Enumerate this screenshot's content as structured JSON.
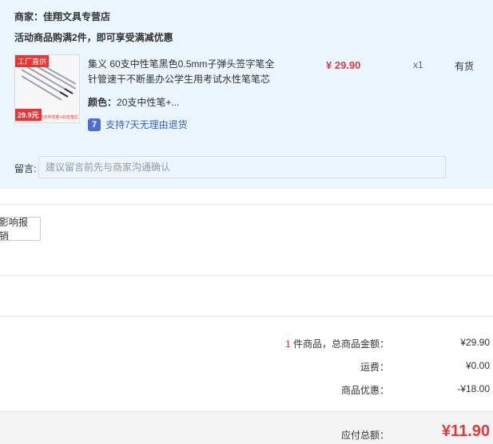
{
  "shop": {
    "merchant": "商家：佳翔文具专营店",
    "promo": "活动商品购满2件，即可享受满减优惠"
  },
  "product": {
    "thumb_badge_top": "工厂直供",
    "thumb_price": "29.9元",
    "thumb_small": "20支中性笔+60支笔芯",
    "title": "集义 60支中性笔黑色0.5mm子弹头签字笔全针管速干不断墨办公学生用考试水性笔笔芯",
    "price": "¥ 29.90",
    "qty": "x1",
    "stock": "有货",
    "color_label": "颜色：",
    "color_value": "20支中性笔+...",
    "return_icon": "7",
    "return_text": "支持7天无理由退货"
  },
  "note": {
    "label": "留言:",
    "placeholder": "建议留言前先与商家沟通确认"
  },
  "invoice": {
    "button_label": "影响报销"
  },
  "summary": {
    "count": "1",
    "items_label": " 件商品，总商品金额：",
    "items_value": "¥29.90",
    "shipping_label": "运费：",
    "shipping_value": "¥0.00",
    "discount_label": "商品优惠：",
    "discount_value": "-¥18.00",
    "total_label": "应付总额：",
    "total_value": "¥11.90"
  },
  "colors": {
    "accent_red": "#e4393c",
    "panel_bg": "#eaf5fd",
    "link_blue": "#3a64b4"
  }
}
